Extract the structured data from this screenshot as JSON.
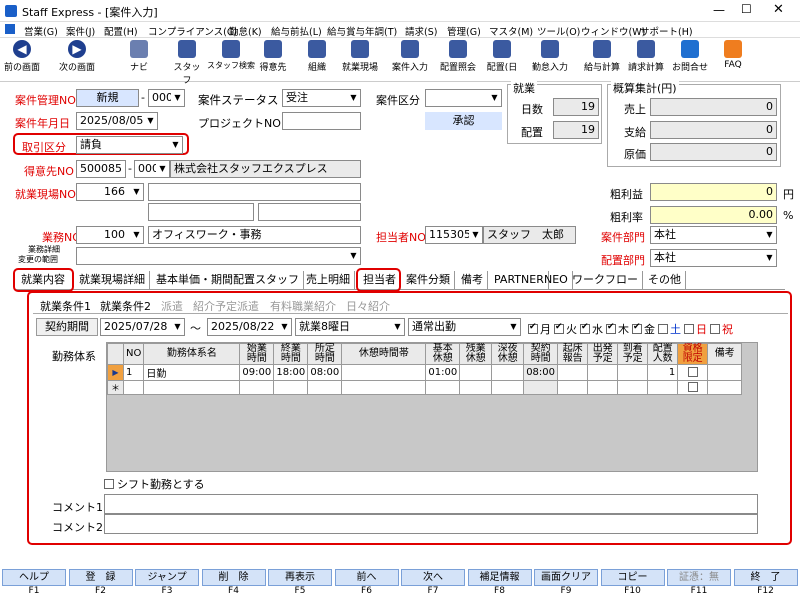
{
  "window": {
    "title": "Staff Express - [案件入力]",
    "min": "—",
    "max": "☐",
    "close": "✕"
  },
  "menu": [
    "営業(G)",
    "案件(J)",
    "配置(H)",
    "コンプライアンス(C)",
    "勤怠(K)",
    "給与前払(L)",
    "給与賞与年調(T)",
    "請求(S)",
    "管理(G)",
    "マスタ(M)",
    "ツール(O)",
    "ウィンドウ(W)",
    "サポート(H)"
  ],
  "toolbar": [
    {
      "label": "前の画面",
      "icon": "arrow-left-icon"
    },
    {
      "label": "次の画面",
      "icon": "arrow-right-icon"
    },
    {
      "label": "ナビ",
      "icon": "navi-icon"
    },
    {
      "label": "スタッフ",
      "icon": "staff-icon"
    },
    {
      "label": "スタッフ検索",
      "icon": "staff-search-icon"
    },
    {
      "label": "得意先",
      "icon": "customer-icon"
    },
    {
      "label": "組織",
      "icon": "organization-icon"
    },
    {
      "label": "就業現場",
      "icon": "worksite-icon"
    },
    {
      "label": "案件入力",
      "icon": "case-input-icon"
    },
    {
      "label": "配置照会",
      "icon": "placement-inquiry-icon"
    },
    {
      "label": "配置(日",
      "icon": "placement-day-icon"
    },
    {
      "label": "勤怠入力",
      "icon": "attendance-icon"
    },
    {
      "label": "給与計算",
      "icon": "payroll-icon"
    },
    {
      "label": "請求計算",
      "icon": "billing-icon"
    },
    {
      "label": "お問合せ",
      "icon": "inquiry-icon"
    },
    {
      "label": "FAQ",
      "icon": "faq-icon"
    }
  ],
  "header": {
    "case_no_label": "案件管理NO",
    "case_no_value": "新規",
    "case_no_sub": "000",
    "status_label": "案件ステータス",
    "status_value": "受注",
    "category_label": "案件区分",
    "category_value": "",
    "date_label": "案件年月日",
    "date_value": "2025/08/05",
    "project_label": "プロジェクトNO",
    "project_value": "",
    "approve_button": "承認",
    "trade_label": "取引区分",
    "trade_value": "請負",
    "customer_label": "得意先NO",
    "customer_value": "500085",
    "customer_sub": "000",
    "customer_name": "株式会社スタッフエクスプレス",
    "site_label": "就業現場NO",
    "site_value": "166",
    "duty_label": "業務NO",
    "duty_value": "100",
    "duty_name": "オフィスワーク・事務",
    "duty_detail_label1": "業務詳細",
    "duty_detail_label2": "変更の範囲",
    "person_label": "担当者NO",
    "person_value": "115305",
    "person_name": "スタッフ　太郎",
    "dept_label": "案件部門",
    "dept_value": "本社",
    "place_dept_label": "配置部門",
    "place_dept_value": "本社"
  },
  "work_panel": {
    "title": "就業",
    "days_label": "日数",
    "days_value": "19",
    "place_label": "配置",
    "place_value": "19"
  },
  "summary_panel": {
    "title": "概算集計(円)",
    "sales_label": "売上",
    "sales_value": "0",
    "pay_label": "支給",
    "pay_value": "0",
    "cost_label": "原価",
    "cost_value": "0"
  },
  "profit": {
    "gross_label": "粗利益",
    "gross_value": "0",
    "gross_unit": "円",
    "rate_label": "粗利率",
    "rate_value": "0.00",
    "rate_unit": "%"
  },
  "tabs": [
    "就業内容",
    "就業現場詳細",
    "基本単価・期間配置スタッフ",
    "売上明細",
    "担当者",
    "案件分類",
    "備考",
    "PARTNER",
    "NEO",
    "ワークフロー",
    "その他"
  ],
  "subtabs": [
    "就業条件1",
    "就業条件2",
    "派遣",
    "紹介予定派遣",
    "有料職業紹介",
    "日々紹介"
  ],
  "contract": {
    "label": "契約期間",
    "from": "2025/07/28",
    "tilde": "～",
    "to": "2025/08/22",
    "day_rule": "就業8曜日",
    "attendance": "通常出勤"
  },
  "weekdays": [
    {
      "label": "月",
      "on": true
    },
    {
      "label": "火",
      "on": true
    },
    {
      "label": "水",
      "on": true
    },
    {
      "label": "木",
      "on": true
    },
    {
      "label": "金",
      "on": true
    },
    {
      "label": "土",
      "on": false
    },
    {
      "label": "日",
      "on": false
    },
    {
      "label": "祝",
      "on": false
    }
  ],
  "grid": {
    "label": "勤務体系",
    "headers": [
      "NO",
      "勤務体系名",
      "始業時間",
      "終業時間",
      "所定時間",
      "休憩時間帯",
      "基本休憩",
      "残業休憩",
      "深夜休憩",
      "契約時間",
      "起床報告",
      "出発予定",
      "到着予定",
      "配置人数",
      "資格限定",
      "備考"
    ],
    "rows": [
      {
        "marker": "▶",
        "no": "1",
        "name": "日勤",
        "start": "09:00",
        "end": "18:00",
        "fixed": "08:00",
        "break_band": "",
        "basic_break": "01:00",
        "ot_break": "",
        "night_break": "",
        "contract": "08:00",
        "wake": "",
        "depart": "",
        "arrive": "",
        "count": "1",
        "qual": "",
        "note": ""
      },
      {
        "marker": "＊",
        "no": "",
        "name": "",
        "start": "",
        "end": "",
        "fixed": "",
        "break_band": "",
        "basic_break": "",
        "ot_break": "",
        "night_break": "",
        "contract": "",
        "wake": "",
        "depart": "",
        "arrive": "",
        "count": "",
        "qual": "",
        "note": ""
      }
    ]
  },
  "shift_label": "シフト勤務とする",
  "comment1_label": "コメント1",
  "comment2_label": "コメント2",
  "fkeys": [
    {
      "label": "ヘルプ",
      "key": "F1"
    },
    {
      "label": "登　録",
      "key": "F2"
    },
    {
      "label": "ジャンプ",
      "key": "F3"
    },
    {
      "label": "削　除",
      "key": "F4"
    },
    {
      "label": "再表示",
      "key": "F5"
    },
    {
      "label": "前へ",
      "key": "F6"
    },
    {
      "label": "次へ",
      "key": "F7"
    },
    {
      "label": "補足情報",
      "key": "F8"
    },
    {
      "label": "画面クリア",
      "key": "F9"
    },
    {
      "label": "コピー",
      "key": "F10"
    },
    {
      "label": "証憑：無",
      "key": "F11"
    },
    {
      "label": "終　了",
      "key": "F12"
    }
  ]
}
